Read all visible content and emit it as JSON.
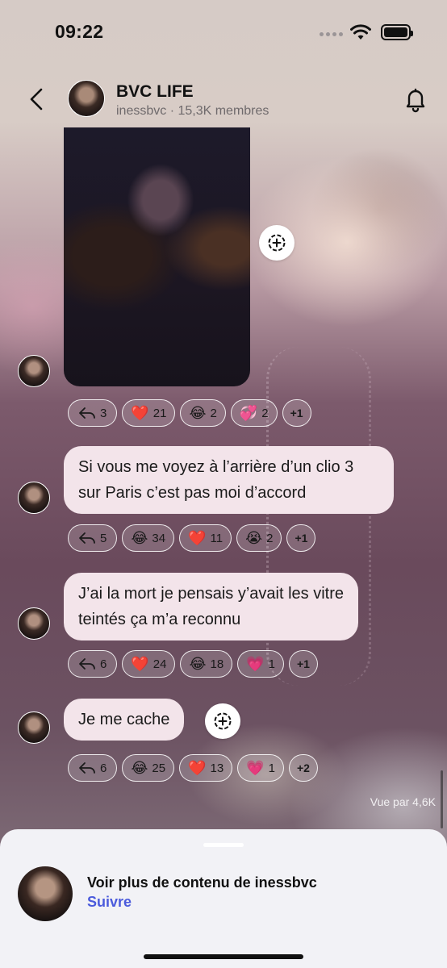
{
  "status_bar": {
    "time": "09:22"
  },
  "header": {
    "title": "BVC LIFE",
    "owner": "inessbvc",
    "members": "15,3K membres"
  },
  "messages": [
    {
      "type": "media",
      "reactions": [
        {
          "kind": "reply",
          "count": "3"
        },
        {
          "emoji": "❤️",
          "count": "21"
        },
        {
          "emoji": "😂",
          "count": "2"
        },
        {
          "emoji": "💞",
          "count": "2"
        },
        {
          "more": "+1"
        }
      ]
    },
    {
      "type": "text",
      "text": "Si vous me voyez à l’arrière d’un clio 3 sur Paris c’est pas moi d’accord",
      "reactions": [
        {
          "kind": "reply",
          "count": "5"
        },
        {
          "emoji": "😂",
          "count": "34"
        },
        {
          "emoji": "❤️",
          "count": "11"
        },
        {
          "emoji": "😭",
          "count": "2"
        },
        {
          "more": "+1"
        }
      ]
    },
    {
      "type": "text",
      "text": "J’ai la mort je pensais y’avait les vitre teintés ça m’a reconnu",
      "reactions": [
        {
          "kind": "reply",
          "count": "6"
        },
        {
          "emoji": "❤️",
          "count": "24"
        },
        {
          "emoji": "😂",
          "count": "18"
        },
        {
          "emoji": "💗",
          "count": "1"
        },
        {
          "more": "+1"
        }
      ]
    },
    {
      "type": "text",
      "text": "Je me cache",
      "reactions": [
        {
          "kind": "reply",
          "count": "6"
        },
        {
          "emoji": "😂",
          "count": "25"
        },
        {
          "emoji": "❤️",
          "count": "13"
        },
        {
          "emoji": "💗",
          "count": "1"
        },
        {
          "more": "+2"
        }
      ]
    }
  ],
  "seen_by": "Vue par 4,6K",
  "bottom_sheet": {
    "prompt": "Voir plus de contenu de inessbvc",
    "follow_label": "Suivre"
  },
  "colors": {
    "bubble": "#f3e4ea",
    "follow_link": "#4b5bdc"
  }
}
